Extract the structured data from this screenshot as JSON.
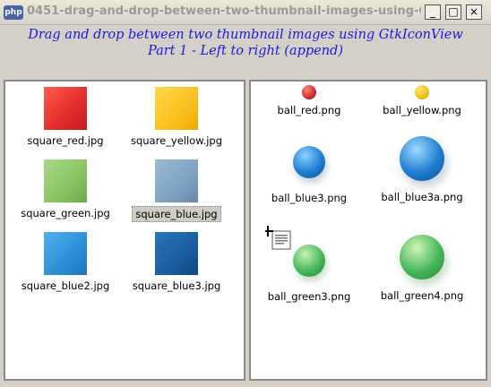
{
  "window": {
    "title": "0451-drag-and-drop-between-two-thumbnail-images-using-G...",
    "app_icon": "php",
    "minimize": "_",
    "maximize": "□",
    "close": "×"
  },
  "header": {
    "line1": "Drag and drop between two thumbnail images using GtkIconView",
    "line2": "Part 1 - Left to right (append)"
  },
  "left_items": [
    {
      "label": "square_red.jpg",
      "color": "#e32b2b"
    },
    {
      "label": "square_yellow.jpg",
      "color": "#f9c11d"
    },
    {
      "label": "square_green.jpg",
      "color": "#8ac45f"
    },
    {
      "label": "square_blue.jpg",
      "color": "#7ea3c2"
    },
    {
      "label": "square_blue2.jpg",
      "color": "#2c8fd6"
    },
    {
      "label": "square_blue3.jpg",
      "color": "#1a5d9e"
    }
  ],
  "right_items": [
    {
      "label": "ball_red.png",
      "color": "#d62828"
    },
    {
      "label": "ball_yellow.png",
      "color": "#f3bd10"
    },
    {
      "label": "ball_blue3.png",
      "color": "#1f7fd1"
    },
    {
      "label": "ball_blue3a.png",
      "color": "#1f7fd1"
    },
    {
      "label": "ball_green3.png",
      "color": "#48b85a"
    },
    {
      "label": "ball_green4.png",
      "color": "#48b85a"
    }
  ]
}
